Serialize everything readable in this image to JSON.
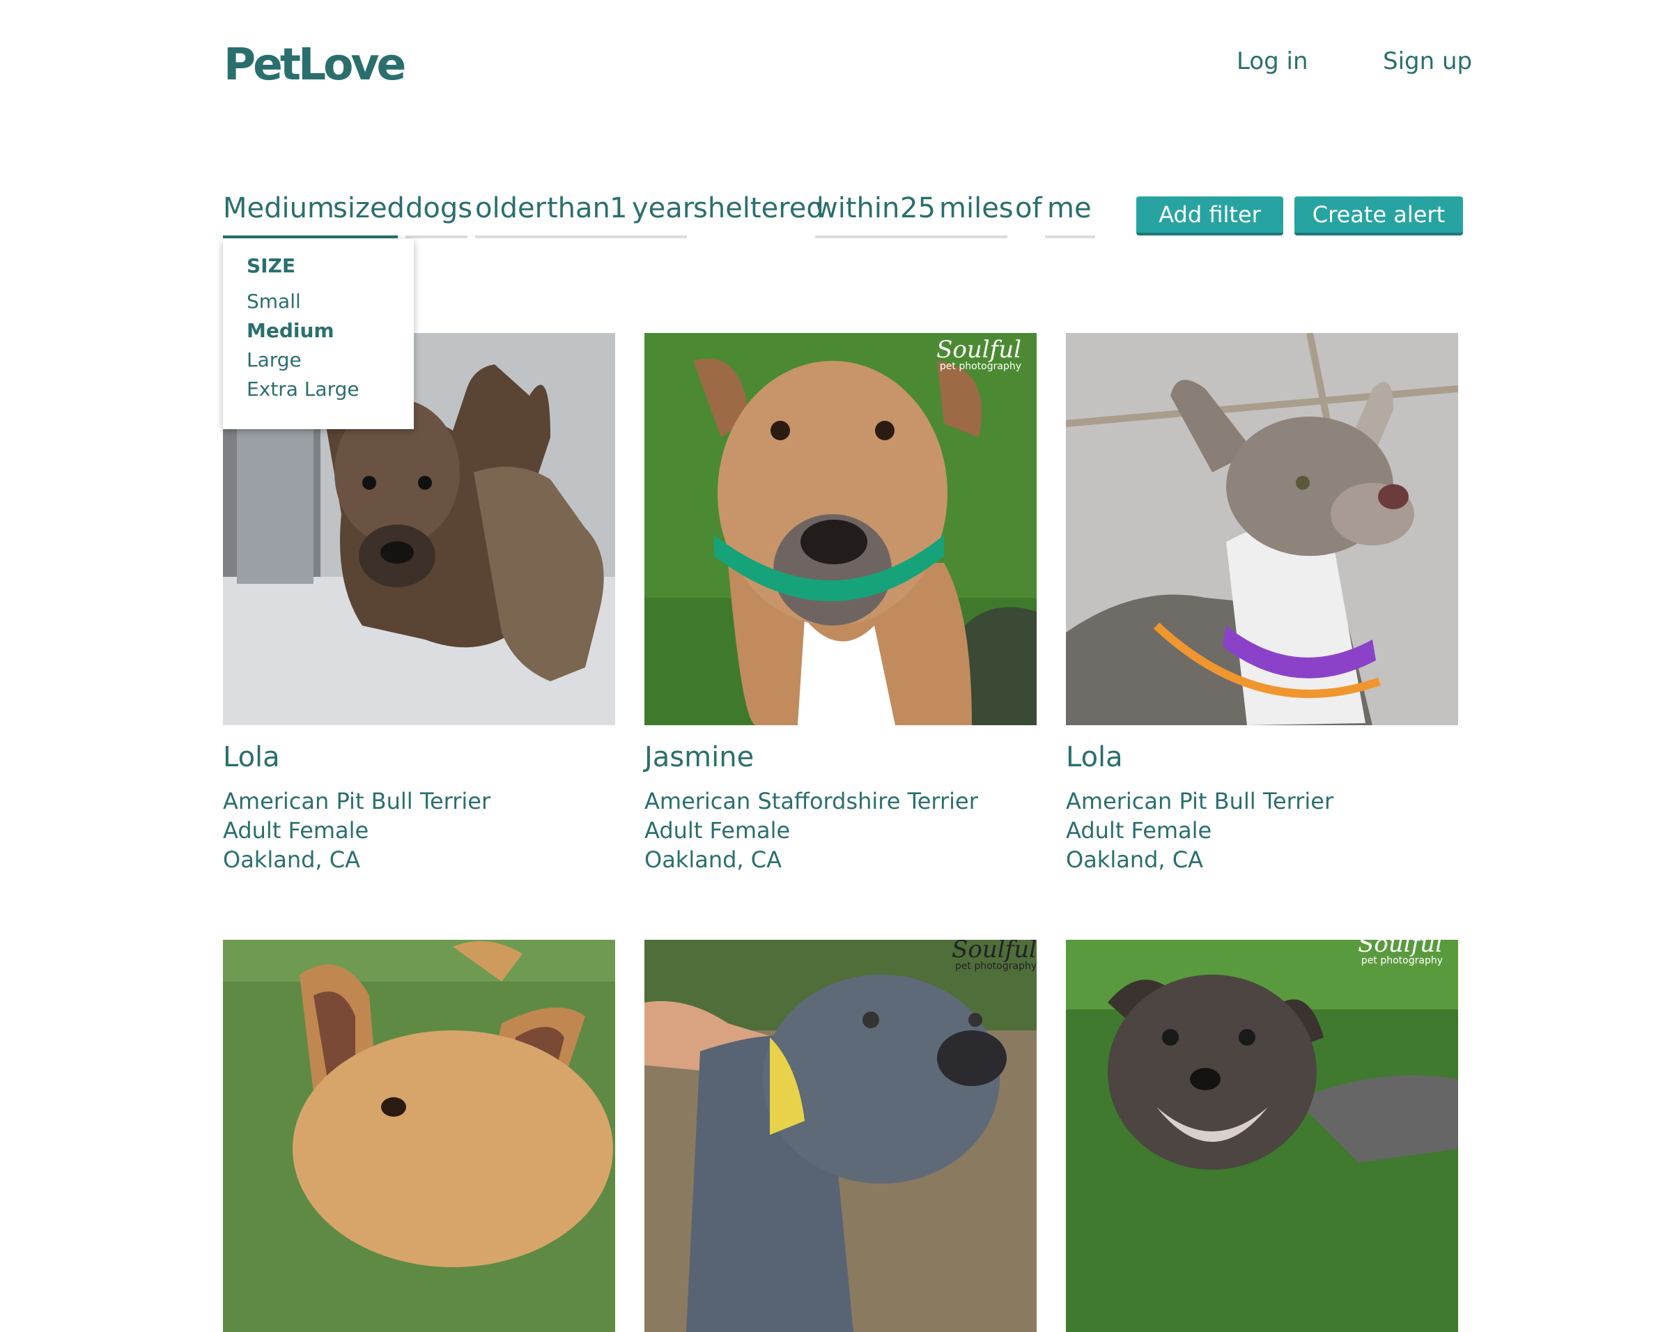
{
  "header": {
    "logo": "PetLove",
    "login_label": "Log in",
    "signup_label": "Sign up"
  },
  "query": {
    "tokens": [
      "Medium",
      "sized",
      "dogs",
      "older",
      "than",
      "1",
      "year",
      "sheltered",
      "within",
      "25",
      "miles",
      "of",
      "me"
    ],
    "add_filter_label": "Add filter",
    "create_alert_label": "Create alert"
  },
  "size_dropdown": {
    "title": "SIZE",
    "options": [
      "Small",
      "Medium",
      "Large",
      "Extra Large"
    ],
    "selected": "Medium"
  },
  "watermark": {
    "brand": "Soulful",
    "sub": "pet photography"
  },
  "pets": [
    {
      "name": "Lola",
      "breed": "American Pit Bull Terrier",
      "age_sex": "Adult Female",
      "location": "Oakland, CA"
    },
    {
      "name": "Jasmine",
      "breed": "American Staffordshire Terrier",
      "age_sex": "Adult Female",
      "location": "Oakland, CA"
    },
    {
      "name": "Lola",
      "breed": "American Pit Bull Terrier",
      "age_sex": "Adult Female",
      "location": "Oakland, CA"
    },
    {
      "name": "",
      "breed": "",
      "age_sex": "",
      "location": ""
    },
    {
      "name": "",
      "breed": "",
      "age_sex": "",
      "location": ""
    },
    {
      "name": "",
      "breed": "",
      "age_sex": "",
      "location": ""
    }
  ],
  "colors": {
    "brand": "#2a6f6d",
    "button": "#27a4a1",
    "underline": "#dcdcdc"
  }
}
